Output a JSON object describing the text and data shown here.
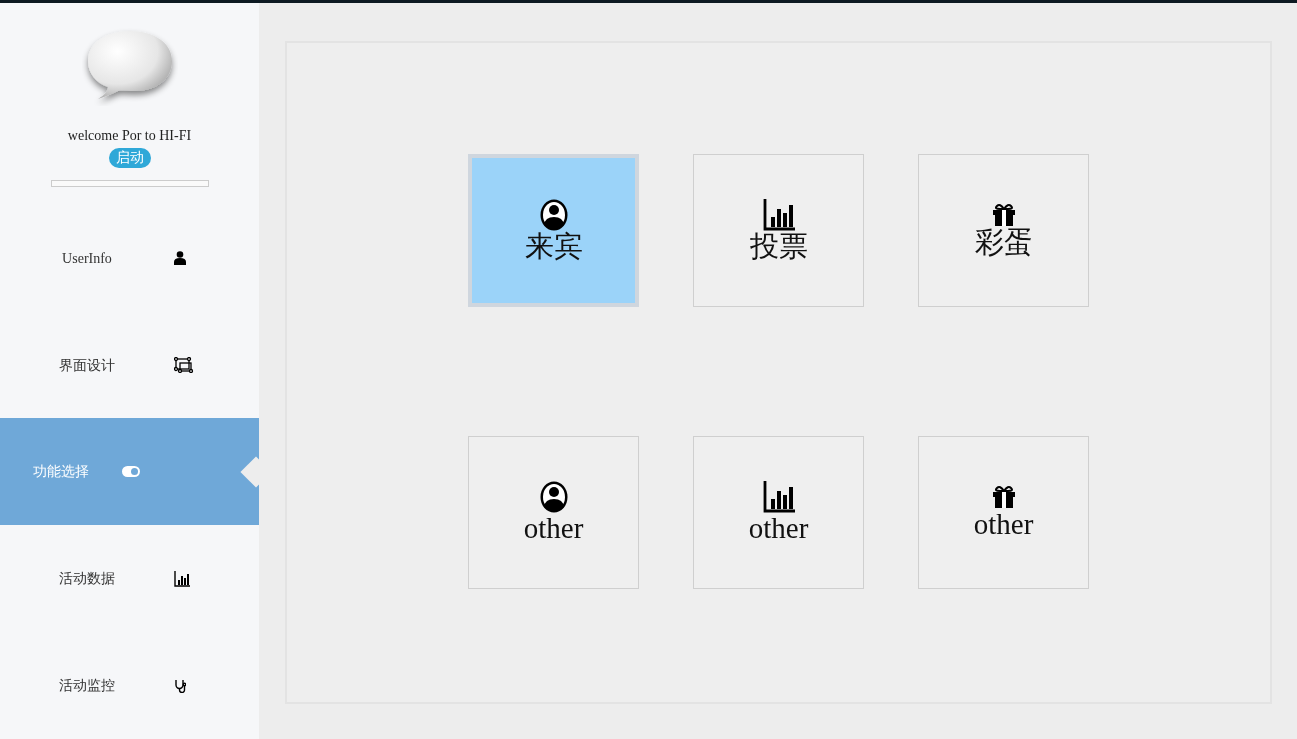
{
  "sidebar": {
    "welcome": "welcome Por to HI-FI",
    "start_badge": "启动",
    "progress": {
      "level": 0
    },
    "items": [
      {
        "label": "UserInfo",
        "selected": false
      },
      {
        "label": "界面设计",
        "selected": false
      },
      {
        "label": "功能选择",
        "selected": true
      },
      {
        "label": "活动数据",
        "selected": false
      },
      {
        "label": "活动监控",
        "selected": false
      }
    ]
  },
  "tiles": [
    {
      "label": "来宾",
      "selected": true
    },
    {
      "label": "投票",
      "selected": false
    },
    {
      "label": "彩蛋",
      "selected": false
    },
    {
      "label": "other",
      "selected": false
    },
    {
      "label": "other",
      "selected": false
    },
    {
      "label": "other",
      "selected": false
    }
  ]
}
